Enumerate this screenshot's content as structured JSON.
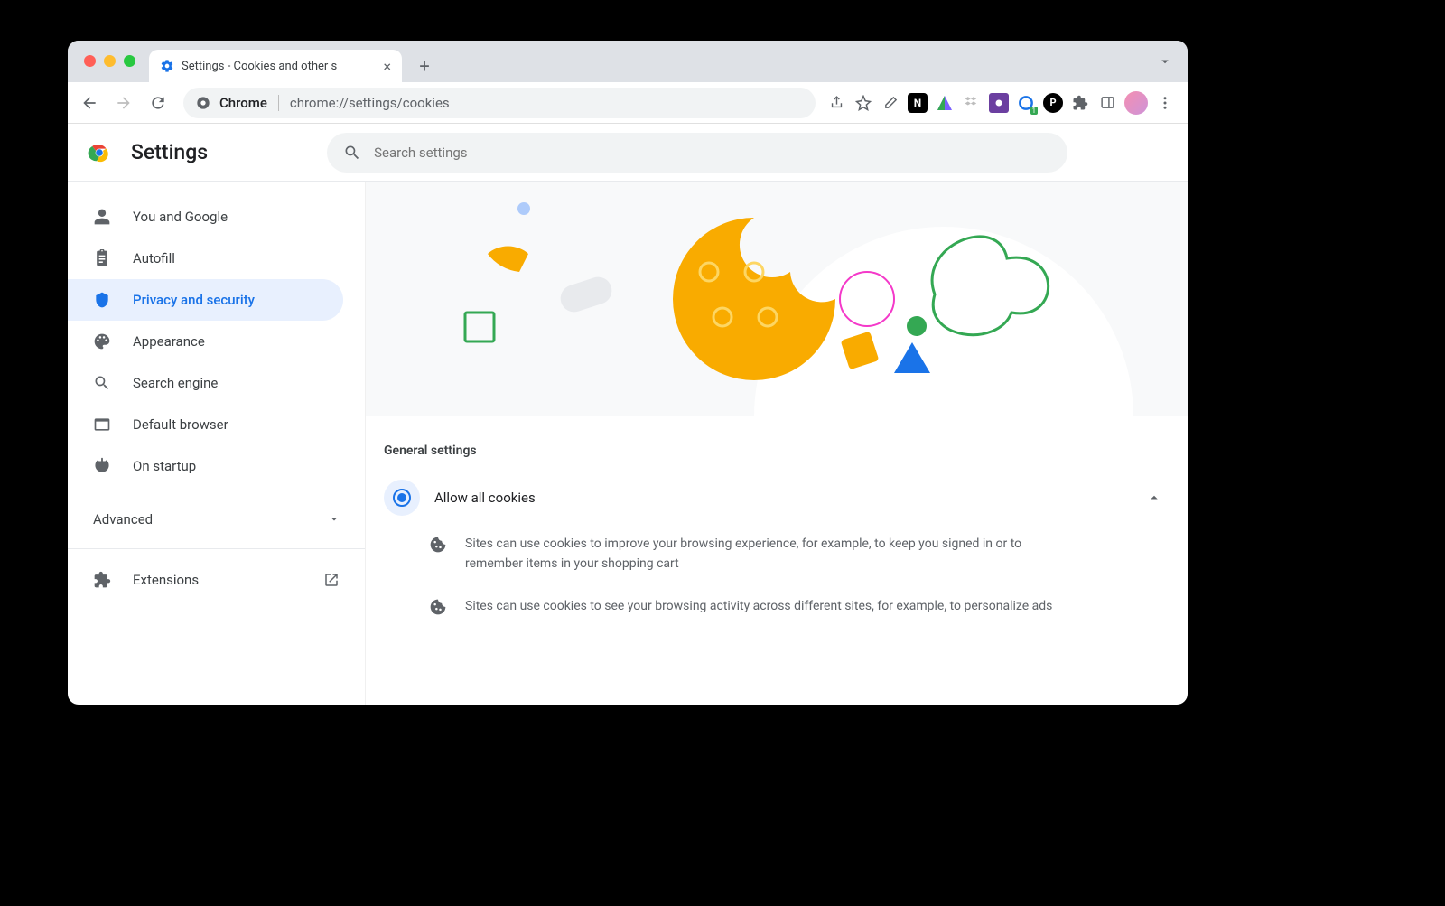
{
  "tab": {
    "title": "Settings - Cookies and other s"
  },
  "omnibox": {
    "label": "Chrome",
    "url": "chrome://settings/cookies"
  },
  "header": {
    "title": "Settings"
  },
  "search": {
    "placeholder": "Search settings"
  },
  "sidebar": {
    "items": [
      {
        "label": "You and Google"
      },
      {
        "label": "Autofill"
      },
      {
        "label": "Privacy and security"
      },
      {
        "label": "Appearance"
      },
      {
        "label": "Search engine"
      },
      {
        "label": "Default browser"
      },
      {
        "label": "On startup"
      }
    ],
    "advanced": "Advanced",
    "extensions": "Extensions"
  },
  "main": {
    "section_label": "General settings",
    "option": {
      "label": "Allow all cookies",
      "detail1": "Sites can use cookies to improve your browsing experience, for example, to keep you signed in or to remember items in your shopping cart",
      "detail2": "Sites can use cookies to see your browsing activity across different sites, for example, to personalize ads"
    }
  },
  "colors": {
    "close_red": "#ff5f57",
    "min_yellow": "#febc2e",
    "max_green": "#28c840",
    "primary": "#1a73e8"
  }
}
